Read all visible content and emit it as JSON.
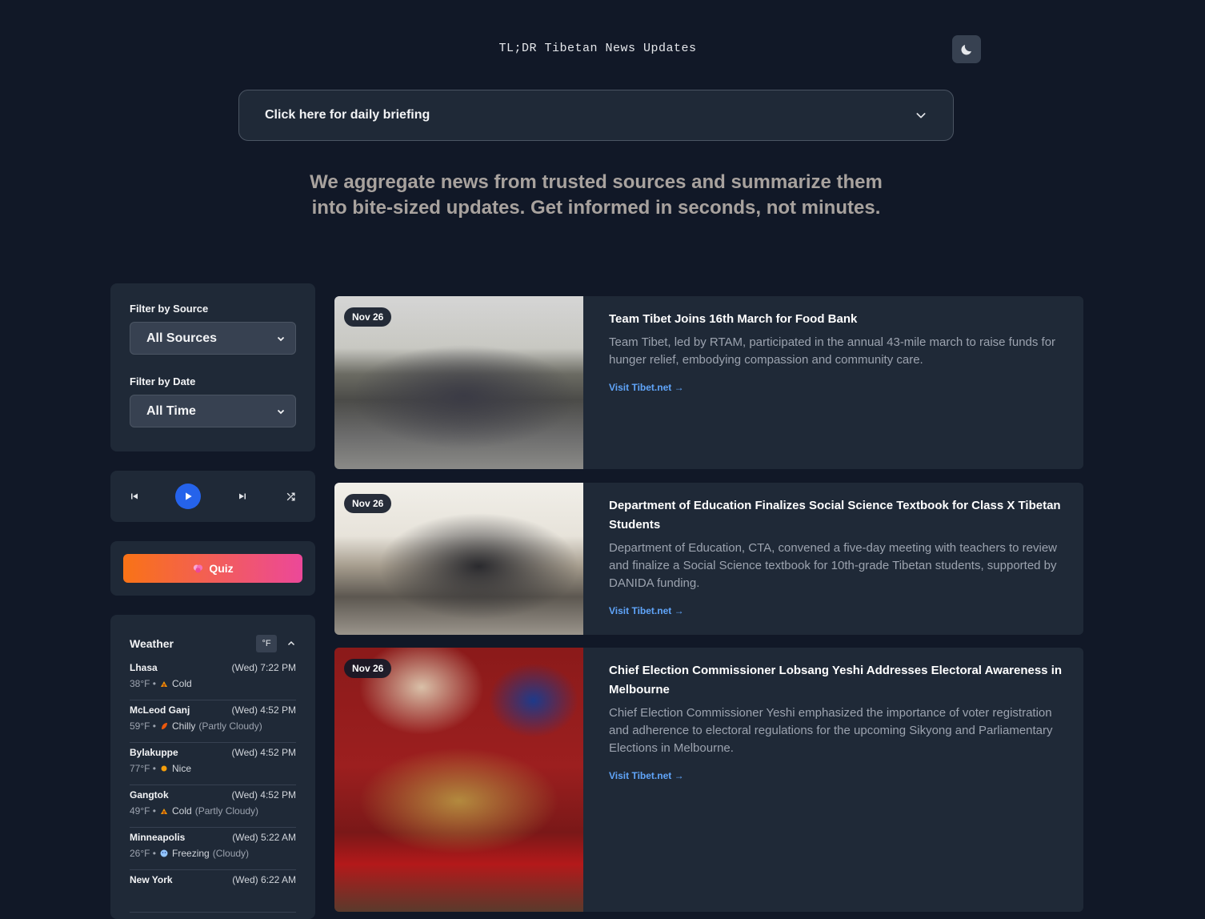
{
  "header": {
    "title": "TL;DR Tibetan News Updates",
    "briefing_label": "Click here for daily briefing",
    "tagline": "We aggregate news from trusted sources and summarize them into bite-sized updates. Get informed in seconds, not minutes."
  },
  "filters": {
    "source_label": "Filter by Source",
    "source_value": "All Sources",
    "date_label": "Filter by Date",
    "date_value": "All Time"
  },
  "quiz": {
    "label": "Quiz"
  },
  "weather": {
    "title": "Weather",
    "unit": "°F",
    "items": [
      {
        "city": "Lhasa",
        "time": "(Wed) 7:22 PM",
        "temp": "38°F •",
        "condition": "Cold",
        "detail": ""
      },
      {
        "city": "McLeod Ganj",
        "time": "(Wed) 4:52 PM",
        "temp": "59°F •",
        "condition": "Chilly",
        "detail": "(Partly Cloudy)"
      },
      {
        "city": "Bylakuppe",
        "time": "(Wed) 4:52 PM",
        "temp": "77°F •",
        "condition": "Nice",
        "detail": ""
      },
      {
        "city": "Gangtok",
        "time": "(Wed) 4:52 PM",
        "temp": "49°F •",
        "condition": "Cold",
        "detail": "(Partly Cloudy)"
      },
      {
        "city": "Minneapolis",
        "time": "(Wed) 5:22 AM",
        "temp": "26°F •",
        "condition": "Freezing",
        "detail": "(Cloudy)"
      },
      {
        "city": "New York",
        "time": "(Wed) 6:22 AM",
        "temp": "",
        "condition": "",
        "detail": ""
      }
    ]
  },
  "articles": [
    {
      "date": "Nov 26",
      "title": "Team Tibet Joins 16th March for Food Bank",
      "summary": "Team Tibet, led by RTAM, participated in the annual 43-mile march to raise funds for hunger relief, embodying compassion and community care.",
      "link": "Visit Tibet.net →"
    },
    {
      "date": "Nov 26",
      "title": "Department of Education Finalizes Social Science Textbook for Class X Tibetan Students",
      "summary": "Department of Education, CTA, convened a five-day meeting with teachers to review and finalize a Social Science textbook for 10th-grade Tibetan students, supported by DANIDA funding.",
      "link": "Visit Tibet.net →"
    },
    {
      "date": "Nov 26",
      "title": "Chief Election Commissioner Lobsang Yeshi Addresses Electoral Awareness in Melbourne",
      "summary": "Chief Election Commissioner Yeshi emphasized the importance of voter registration and adherence to electoral regulations for the upcoming Sikyong and Parliamentary Elections in Melbourne.",
      "link": "Visit Tibet.net →"
    }
  ]
}
